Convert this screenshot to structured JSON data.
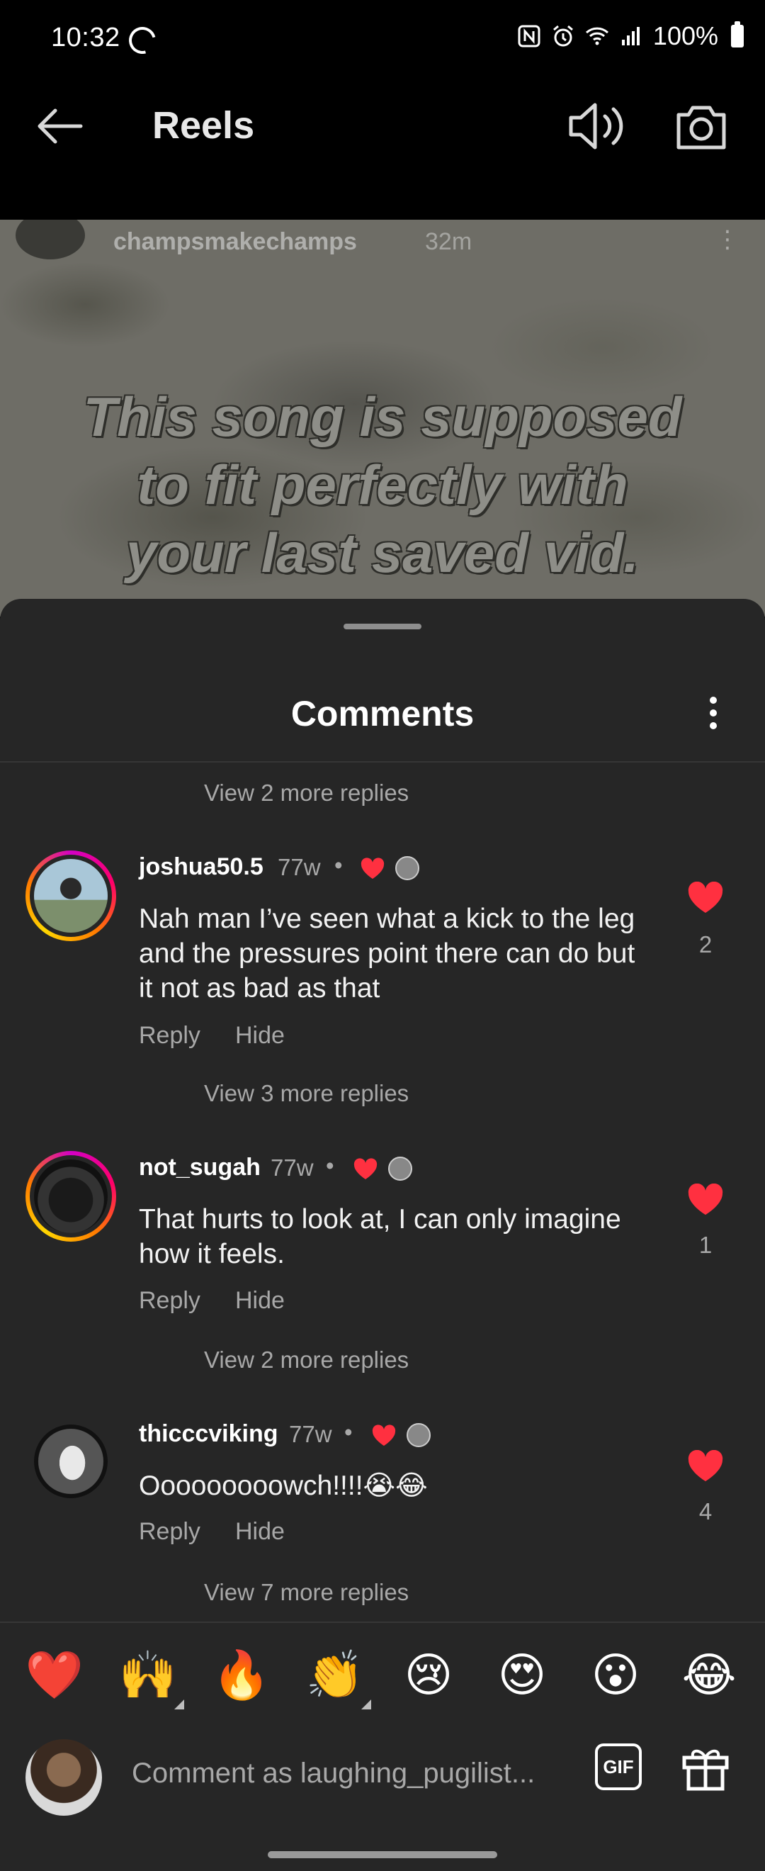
{
  "status": {
    "time": "10:32",
    "battery": "100%"
  },
  "nav": {
    "title": "Reels"
  },
  "video": {
    "username": "champsmakechamps",
    "age": "32m",
    "caption_lines": [
      "This song is supposed",
      "to fit perfectly with",
      "your last saved vid."
    ]
  },
  "sheet": {
    "title": "Comments"
  },
  "view_more": {
    "first": "View 2 more replies",
    "second": "View 3 more replies",
    "third": "View 2 more replies",
    "fourth": "View 7 more replies"
  },
  "comments": [
    {
      "username": "joshua50.5",
      "age": "77w",
      "text": "Nah man I’ve seen what a kick to the leg and the pressures point there can do but it not as bad as that",
      "likes": "2",
      "reply": "Reply",
      "hide": "Hide"
    },
    {
      "username": "not_sugah",
      "age": "77w",
      "text": "That hurts to look at, I can only imagine how it feels.",
      "likes": "1",
      "reply": "Reply",
      "hide": "Hide"
    },
    {
      "username": "thicccviking",
      "age": "77w",
      "text": "Ooooooooowch!!!!😭😂",
      "likes": "4",
      "reply": "Reply",
      "hide": "Hide"
    }
  ],
  "emoji_bar": [
    "❤️",
    "🙌",
    "🔥",
    "👏",
    "😢",
    "😍",
    "😮",
    "😂"
  ],
  "input": {
    "placeholder": "Comment as laughing_pugilist...",
    "gif_label": "GIF"
  },
  "colors": {
    "heart": "#ff3040",
    "sheet_bg": "#262626",
    "muted_text": "#a8a8a8"
  }
}
